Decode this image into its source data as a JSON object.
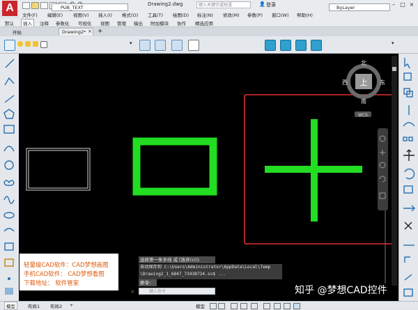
{
  "app": {
    "logo": "A",
    "doc_title": "Drawing2.dwg",
    "search_placeholder": "键入关键字或短语",
    "login": "登录"
  },
  "menu": [
    "文件(F)",
    "编辑(E)",
    "视图(V)",
    "插入(I)",
    "格式(O)",
    "工具(T)",
    "绘图(D)",
    "标注(N)",
    "修改(M)",
    "参数(P)",
    "窗口(W)",
    "帮助(H)"
  ],
  "ribbon_tabs": [
    "默认",
    "插入",
    "注释",
    "参数化",
    "可视化",
    "视图",
    "管理",
    "输出",
    "附加模块",
    "协作",
    "精选应用"
  ],
  "ribbon_active": "插入",
  "file_tabs": {
    "start": "开始",
    "drawing": "Drawing2*",
    "add": "+"
  },
  "toolbar": {
    "layer_name": "PUB_TEXT",
    "linetype": "ByLayer"
  },
  "viewcube": {
    "north": "北",
    "south": "南",
    "east": "东",
    "west": "西",
    "top": "上",
    "wcs": "WCS"
  },
  "promo": {
    "line1": "轻量级CAD软件：CAD梦想画图",
    "line2": "手机CAD软件：  CAD梦想看图",
    "line3": "下载地址：    软件管家"
  },
  "command": {
    "hint": "选择第一条多线 或 [放弃(U)]:",
    "history1": "自动保存到 C:\\Users\\Administrator\\AppData\\Local\\Temp",
    "history2": "\\Drawing2_1_6847_73438734.sv$ ...",
    "input": "命令:",
    "prompt": "键入命令",
    "close": "×"
  },
  "status": {
    "model": "模型",
    "layout1": "布局1",
    "layout2": "布局2",
    "add": "+",
    "model_btn": "模型"
  },
  "watermark": "知乎 @梦想CAD控件",
  "colors": {
    "canvas": "#000000",
    "shape_green": "#22dd22",
    "highlight": "#e03030",
    "promo_text": "#e05a0c"
  }
}
